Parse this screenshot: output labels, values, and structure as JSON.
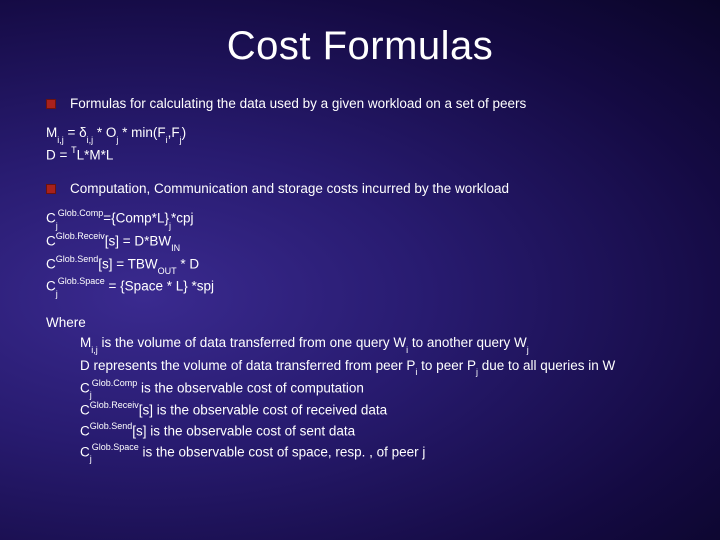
{
  "title": "Cost Formulas",
  "bullet1": "Formulas for calculating the data used by a given workload on a set of peers",
  "formula1_line1_html": "M<span class='sub'>i,j</span> = δ<span class='sub'>i,j</span> * O<span class='sub'>j</span> * min(F<span class='sub'>i</span>,F<span class='sub'>j</span>)",
  "formula1_line2_html": "D = <span class='sup'>T</span>L*M*L",
  "bullet2": "Computation, Communication and storage costs incurred by the workload",
  "formula2_line1_html": "C<span class='sub'>j</span><span class='sup'>Glob.Comp</span>={Comp*L}<span class='sub'>j</span>*cpj",
  "formula2_line2_html": "C<span class='sup'>Glob.Receiv</span>[s] = D*BW<span class='sub'>IN</span>",
  "formula2_line3_html": "C<span class='sup'>Glob.Send</span>[s] = TBW<span class='sub'>OUT</span> * D",
  "formula2_line4_html": "C<span class='sub'>j</span><span class='sup'>Glob.Space</span> = {Space * L} *spj",
  "where_label": "Where",
  "where_line1_html": "M<span class='sub'>i,j</span> is the volume of data transferred from one query W<span class='sub'>i</span> to another query W<span class='sub'>j</span>",
  "where_line2_html": "D represents the volume of data transferred from peer P<span class='sub'>i</span> to peer P<span class='sub'>j</span> due to all queries in W",
  "where_line3_html": "C<span class='sub'>j</span><span class='sup'>Glob.Comp</span> is the observable cost of computation",
  "where_line4_html": "C<span class='sup'>Glob.Receiv</span>[s] is the observable cost of received data",
  "where_line5_html": "C<span class='sup'>Glob.Send</span>[s] is the observable cost of sent data",
  "where_line6_html": "C<span class='sub'>j</span><span class='sup'>Glob.Space</span> is the observable cost of space, resp. , of peer j"
}
